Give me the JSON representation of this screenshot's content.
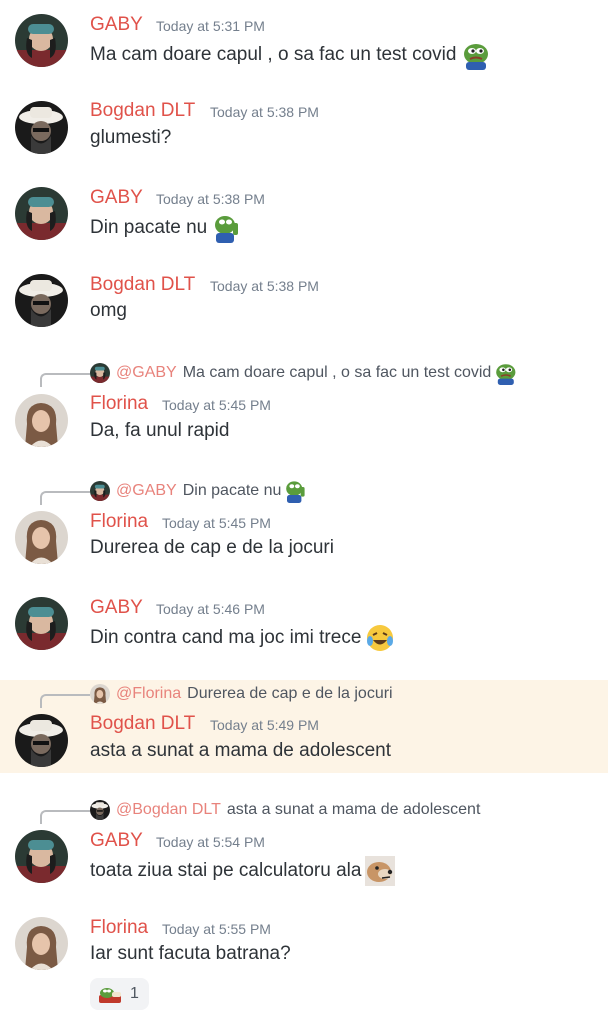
{
  "messages": [
    {
      "author": "GABY",
      "time": "Today at 5:31 PM",
      "text": "Ma cam doare capul , o sa fac un test covid",
      "avatar": "gaby",
      "emoji": "pepe-sad-icon"
    },
    {
      "author": "Bogdan DLT",
      "time": "Today at 5:38 PM",
      "text": "glumesti?",
      "avatar": "bogdan"
    },
    {
      "author": "GABY",
      "time": "Today at 5:38 PM",
      "text": "Din pacate nu",
      "avatar": "gaby",
      "emoji": "pepe-thumbs-icon"
    },
    {
      "author": "Bogdan DLT",
      "time": "Today at 5:38 PM",
      "text": "omg",
      "avatar": "bogdan"
    },
    {
      "author": "Florina",
      "time": "Today at 5:45 PM",
      "text": "Da, fa unul rapid",
      "avatar": "florina",
      "reply": {
        "mention": "@GABY",
        "text": "Ma cam doare capul , o sa fac un test covid",
        "avatar": "gaby",
        "emoji": "pepe-sad-icon"
      }
    },
    {
      "author": "Florina",
      "time": "Today at 5:45 PM",
      "text": "Durerea de cap e de la jocuri",
      "avatar": "florina",
      "reply": {
        "mention": "@GABY",
        "text": "Din pacate nu",
        "avatar": "gaby",
        "emoji": "pepe-thumbs-icon"
      }
    },
    {
      "author": "GABY",
      "time": "Today at 5:46 PM",
      "text": "Din contra cand ma joc imi trece",
      "avatar": "gaby",
      "emoji": "crying-laughing-icon"
    },
    {
      "author": "Bogdan DLT",
      "time": "Today at 5:49 PM",
      "text": "asta a sunat a mama de adolescent",
      "avatar": "bogdan",
      "highlight": true,
      "reply": {
        "mention": "@Florina",
        "text": "Durerea de cap e de la jocuri",
        "avatar": "florina"
      }
    },
    {
      "author": "GABY",
      "time": "Today at 5:54 PM",
      "text": "toata ziua stai pe calculatoru ala",
      "avatar": "gaby",
      "emoji": "dog-icon",
      "reply": {
        "mention": "@Bogdan DLT",
        "text": "asta a sunat a mama de adolescent",
        "avatar": "bogdan"
      }
    },
    {
      "author": "Florina",
      "time": "Today at 5:55 PM",
      "text": "Iar sunt facuta batrana?",
      "avatar": "florina",
      "reaction": {
        "emoji": "pepe-bed-icon",
        "count": "1"
      }
    }
  ],
  "colors": {
    "author": "#e0524a",
    "mention": "#e8837c",
    "highlight": "#fdf4e6"
  }
}
